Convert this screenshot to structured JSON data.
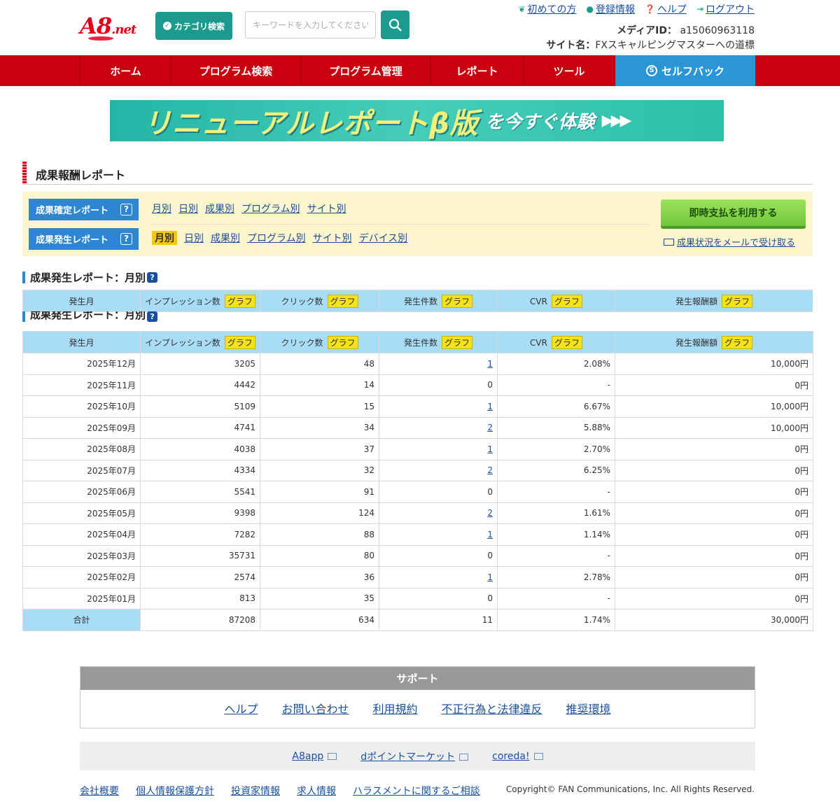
{
  "header": {
    "logo": "A8",
    "logo_suffix": ".net",
    "category_button": "カテゴリ検索",
    "search_placeholder": "キーワードを入力してください",
    "links": [
      {
        "icon": "leaf-icon",
        "label": "初めての方"
      },
      {
        "icon": "person-icon",
        "label": "登録情報"
      },
      {
        "icon": "help-icon",
        "label": "ヘルプ"
      },
      {
        "icon": "logout-icon",
        "label": "ログアウト"
      }
    ],
    "media_id_label": "メディアID：",
    "media_id": "a15060963118",
    "site_label": "サイト名：",
    "site_name": "FXスキャルピングマスターへの道標"
  },
  "nav": {
    "items": [
      "ホーム",
      "プログラム検索",
      "プログラム管理",
      "レポート",
      "ツール"
    ],
    "selfback": "セルフバック"
  },
  "banner": {
    "main": "リニューアルレポートβ版",
    "sub": "を今すぐ体験",
    "arrows": "▶▶▶"
  },
  "section_title": "成果報酬レポート",
  "panel": {
    "confirmed_label": "成果確定レポート",
    "confirmed_links": [
      "月別",
      "日別",
      "成果別",
      "プログラム別",
      "サイト別"
    ],
    "occurred_label": "成果発生レポート",
    "occurred_current": "月別",
    "occurred_links": [
      "日別",
      "成果別",
      "プログラム別",
      "サイト別",
      "デバイス別"
    ],
    "help_mark": "?",
    "pay_button": "即時支払を利用する",
    "mail_link": "成果状況をメールで受け取る"
  },
  "report": {
    "title": "成果発生レポート：月別",
    "help_mark": "?",
    "graph_label": "グラフ",
    "columns": [
      "発生月",
      "インプレッション数",
      "クリック数",
      "発生件数",
      "CVR",
      "発生報酬額"
    ],
    "rows": [
      {
        "month": "2025年12月",
        "imp": "3205",
        "click": "48",
        "count": "1",
        "cvr": "2.08%",
        "reward": "10,000円"
      },
      {
        "month": "2025年11月",
        "imp": "4442",
        "click": "14",
        "count": "0",
        "cvr": "-",
        "reward": "0円"
      },
      {
        "month": "2025年10月",
        "imp": "5109",
        "click": "15",
        "count": "1",
        "cvr": "6.67%",
        "reward": "10,000円"
      },
      {
        "month": "2025年09月",
        "imp": "4741",
        "click": "34",
        "count": "2",
        "cvr": "5.88%",
        "reward": "10,000円"
      },
      {
        "month": "2025年08月",
        "imp": "4038",
        "click": "37",
        "count": "1",
        "cvr": "2.70%",
        "reward": "0円"
      },
      {
        "month": "2025年07月",
        "imp": "4334",
        "click": "32",
        "count": "2",
        "cvr": "6.25%",
        "reward": "0円"
      },
      {
        "month": "2025年06月",
        "imp": "5541",
        "click": "91",
        "count": "0",
        "cvr": "-",
        "reward": "0円"
      },
      {
        "month": "2025年05月",
        "imp": "9398",
        "click": "124",
        "count": "2",
        "cvr": "1.61%",
        "reward": "0円"
      },
      {
        "month": "2025年04月",
        "imp": "7282",
        "click": "88",
        "count": "1",
        "cvr": "1.14%",
        "reward": "0円"
      },
      {
        "month": "2025年03月",
        "imp": "35731",
        "click": "80",
        "count": "0",
        "cvr": "-",
        "reward": "0円"
      },
      {
        "month": "2025年02月",
        "imp": "2574",
        "click": "36",
        "count": "1",
        "cvr": "2.78%",
        "reward": "0円"
      },
      {
        "month": "2025年01月",
        "imp": "813",
        "click": "35",
        "count": "0",
        "cvr": "-",
        "reward": "0円"
      }
    ],
    "total": {
      "label": "合計",
      "imp": "87208",
      "click": "634",
      "count": "11",
      "cvr": "1.74%",
      "reward": "30,000円"
    }
  },
  "support": {
    "title": "サポート",
    "links": [
      "ヘルプ",
      "お問い合わせ",
      "利用規約",
      "不正行為と法律違反",
      "推奨環境"
    ]
  },
  "partners": [
    "A8app",
    "dポイントマーケット",
    "coreda!"
  ],
  "footer": {
    "links": [
      "会社概要",
      "個人情報保護方針",
      "投資家情報",
      "求人情報",
      "ハラスメントに関するご相談"
    ],
    "copyright": "Copyright© FAN Communications, Inc. All Rights Reserved."
  }
}
